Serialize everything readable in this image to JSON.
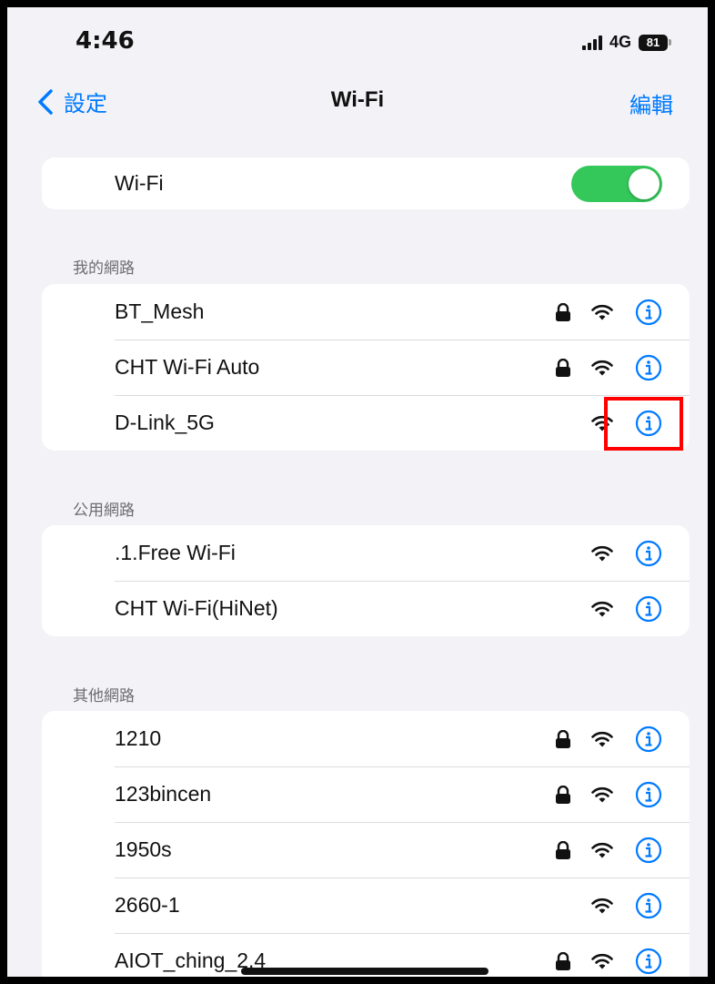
{
  "status_bar": {
    "time": "4:46",
    "network_type": "4G",
    "battery_level": "81"
  },
  "nav": {
    "back_label": "設定",
    "title": "Wi-Fi",
    "edit_label": "編輯"
  },
  "wifi_toggle": {
    "label": "Wi-Fi",
    "on": true
  },
  "sections": [
    {
      "header": "我的網路",
      "networks": [
        {
          "name": "BT_Mesh",
          "locked": true
        },
        {
          "name": "CHT Wi-Fi Auto",
          "locked": true
        },
        {
          "name": "D-Link_5G",
          "locked": false
        }
      ]
    },
    {
      "header": "公用網路",
      "networks": [
        {
          "name": ".1.Free Wi-Fi",
          "locked": false
        },
        {
          "name": "CHT Wi-Fi(HiNet)",
          "locked": false
        }
      ]
    },
    {
      "header": "其他網路",
      "networks": [
        {
          "name": "1210",
          "locked": true
        },
        {
          "name": "123bincen",
          "locked": true
        },
        {
          "name": "1950s",
          "locked": true
        },
        {
          "name": "2660-1",
          "locked": false
        },
        {
          "name": "AIOT_ching_2.4",
          "locked": true
        }
      ]
    }
  ],
  "colors": {
    "accent": "#007aff",
    "toggle_on": "#34c759",
    "highlight": "#ff0000",
    "background": "#f2f2f7"
  }
}
